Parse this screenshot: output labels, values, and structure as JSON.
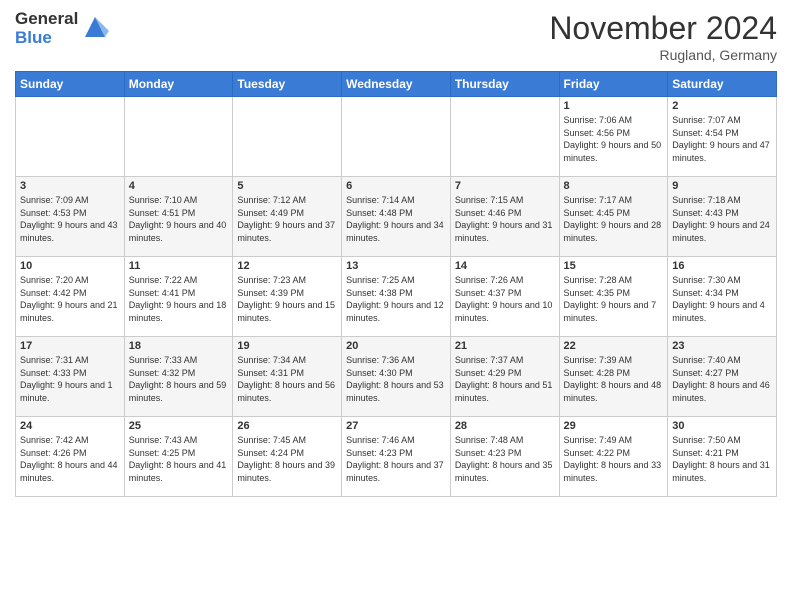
{
  "header": {
    "logo_general": "General",
    "logo_blue": "Blue",
    "month_title": "November 2024",
    "location": "Rugland, Germany"
  },
  "days_of_week": [
    "Sunday",
    "Monday",
    "Tuesday",
    "Wednesday",
    "Thursday",
    "Friday",
    "Saturday"
  ],
  "weeks": [
    [
      {
        "day": "",
        "info": ""
      },
      {
        "day": "",
        "info": ""
      },
      {
        "day": "",
        "info": ""
      },
      {
        "day": "",
        "info": ""
      },
      {
        "day": "",
        "info": ""
      },
      {
        "day": "1",
        "info": "Sunrise: 7:06 AM\nSunset: 4:56 PM\nDaylight: 9 hours\nand 50 minutes."
      },
      {
        "day": "2",
        "info": "Sunrise: 7:07 AM\nSunset: 4:54 PM\nDaylight: 9 hours\nand 47 minutes."
      }
    ],
    [
      {
        "day": "3",
        "info": "Sunrise: 7:09 AM\nSunset: 4:53 PM\nDaylight: 9 hours\nand 43 minutes."
      },
      {
        "day": "4",
        "info": "Sunrise: 7:10 AM\nSunset: 4:51 PM\nDaylight: 9 hours\nand 40 minutes."
      },
      {
        "day": "5",
        "info": "Sunrise: 7:12 AM\nSunset: 4:49 PM\nDaylight: 9 hours\nand 37 minutes."
      },
      {
        "day": "6",
        "info": "Sunrise: 7:14 AM\nSunset: 4:48 PM\nDaylight: 9 hours\nand 34 minutes."
      },
      {
        "day": "7",
        "info": "Sunrise: 7:15 AM\nSunset: 4:46 PM\nDaylight: 9 hours\nand 31 minutes."
      },
      {
        "day": "8",
        "info": "Sunrise: 7:17 AM\nSunset: 4:45 PM\nDaylight: 9 hours\nand 28 minutes."
      },
      {
        "day": "9",
        "info": "Sunrise: 7:18 AM\nSunset: 4:43 PM\nDaylight: 9 hours\nand 24 minutes."
      }
    ],
    [
      {
        "day": "10",
        "info": "Sunrise: 7:20 AM\nSunset: 4:42 PM\nDaylight: 9 hours\nand 21 minutes."
      },
      {
        "day": "11",
        "info": "Sunrise: 7:22 AM\nSunset: 4:41 PM\nDaylight: 9 hours\nand 18 minutes."
      },
      {
        "day": "12",
        "info": "Sunrise: 7:23 AM\nSunset: 4:39 PM\nDaylight: 9 hours\nand 15 minutes."
      },
      {
        "day": "13",
        "info": "Sunrise: 7:25 AM\nSunset: 4:38 PM\nDaylight: 9 hours\nand 12 minutes."
      },
      {
        "day": "14",
        "info": "Sunrise: 7:26 AM\nSunset: 4:37 PM\nDaylight: 9 hours\nand 10 minutes."
      },
      {
        "day": "15",
        "info": "Sunrise: 7:28 AM\nSunset: 4:35 PM\nDaylight: 9 hours\nand 7 minutes."
      },
      {
        "day": "16",
        "info": "Sunrise: 7:30 AM\nSunset: 4:34 PM\nDaylight: 9 hours\nand 4 minutes."
      }
    ],
    [
      {
        "day": "17",
        "info": "Sunrise: 7:31 AM\nSunset: 4:33 PM\nDaylight: 9 hours\nand 1 minute."
      },
      {
        "day": "18",
        "info": "Sunrise: 7:33 AM\nSunset: 4:32 PM\nDaylight: 8 hours\nand 59 minutes."
      },
      {
        "day": "19",
        "info": "Sunrise: 7:34 AM\nSunset: 4:31 PM\nDaylight: 8 hours\nand 56 minutes."
      },
      {
        "day": "20",
        "info": "Sunrise: 7:36 AM\nSunset: 4:30 PM\nDaylight: 8 hours\nand 53 minutes."
      },
      {
        "day": "21",
        "info": "Sunrise: 7:37 AM\nSunset: 4:29 PM\nDaylight: 8 hours\nand 51 minutes."
      },
      {
        "day": "22",
        "info": "Sunrise: 7:39 AM\nSunset: 4:28 PM\nDaylight: 8 hours\nand 48 minutes."
      },
      {
        "day": "23",
        "info": "Sunrise: 7:40 AM\nSunset: 4:27 PM\nDaylight: 8 hours\nand 46 minutes."
      }
    ],
    [
      {
        "day": "24",
        "info": "Sunrise: 7:42 AM\nSunset: 4:26 PM\nDaylight: 8 hours\nand 44 minutes."
      },
      {
        "day": "25",
        "info": "Sunrise: 7:43 AM\nSunset: 4:25 PM\nDaylight: 8 hours\nand 41 minutes."
      },
      {
        "day": "26",
        "info": "Sunrise: 7:45 AM\nSunset: 4:24 PM\nDaylight: 8 hours\nand 39 minutes."
      },
      {
        "day": "27",
        "info": "Sunrise: 7:46 AM\nSunset: 4:23 PM\nDaylight: 8 hours\nand 37 minutes."
      },
      {
        "day": "28",
        "info": "Sunrise: 7:48 AM\nSunset: 4:23 PM\nDaylight: 8 hours\nand 35 minutes."
      },
      {
        "day": "29",
        "info": "Sunrise: 7:49 AM\nSunset: 4:22 PM\nDaylight: 8 hours\nand 33 minutes."
      },
      {
        "day": "30",
        "info": "Sunrise: 7:50 AM\nSunset: 4:21 PM\nDaylight: 8 hours\nand 31 minutes."
      }
    ]
  ]
}
